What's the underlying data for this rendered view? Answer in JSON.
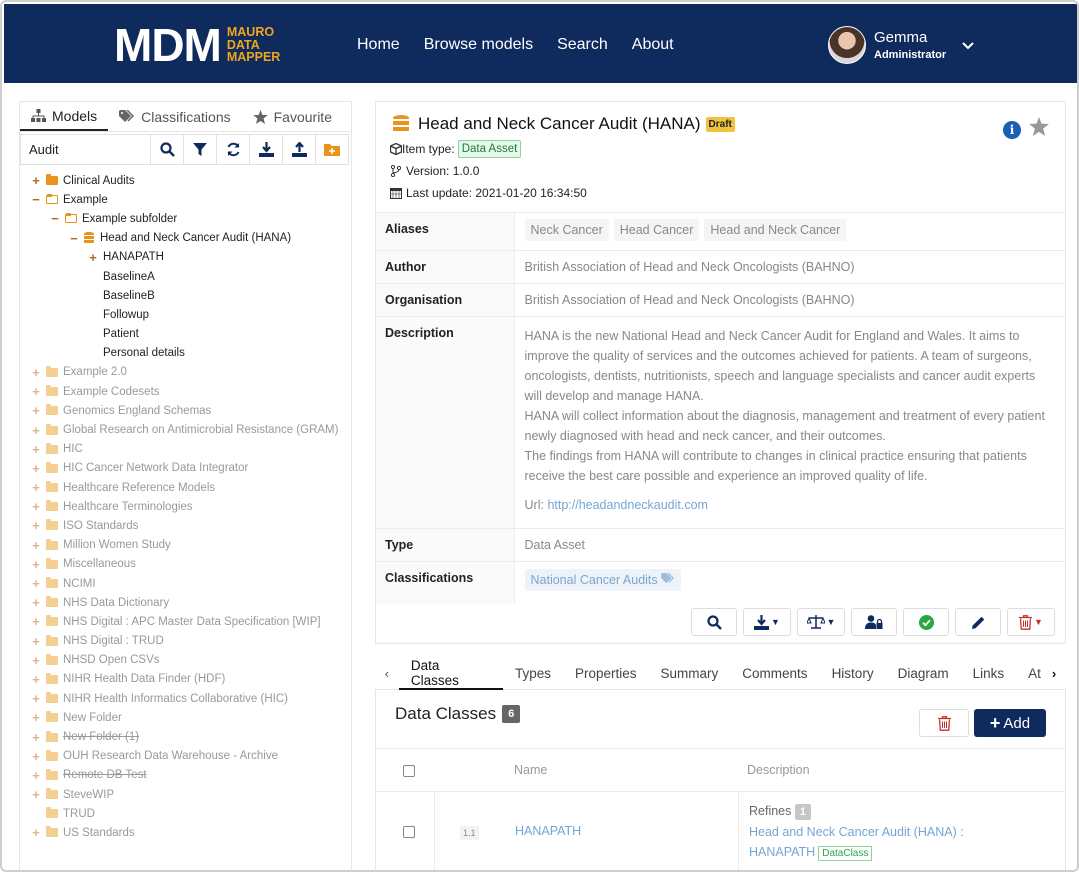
{
  "header": {
    "logo_main": "MDM",
    "logo_sub": [
      "MAURO",
      "DATA",
      "MAPPER"
    ],
    "nav": [
      "Home",
      "Browse models",
      "Search",
      "About"
    ],
    "user_name": "Gemma",
    "user_role": "Administrator"
  },
  "left": {
    "tabs": [
      "Models",
      "Classifications",
      "Favourite"
    ],
    "search_value": "Audit",
    "tree": [
      {
        "label": "Clinical Audits"
      },
      {
        "label": "Example"
      },
      {
        "label": "Example subfolder"
      },
      {
        "label": "Head and Neck Cancer Audit (HANA)"
      },
      {
        "label": "HANAPATH"
      },
      {
        "label": "BaselineA"
      },
      {
        "label": "BaselineB"
      },
      {
        "label": "Followup"
      },
      {
        "label": "Patient"
      },
      {
        "label": "Personal details"
      },
      {
        "label": "Example 2.0"
      },
      {
        "label": "Example Codesets"
      },
      {
        "label": "Genomics England Schemas"
      },
      {
        "label": "Global Research on Antimicrobial Resistance (GRAM)"
      },
      {
        "label": "HIC"
      },
      {
        "label": "HIC Cancer Network Data Integrator"
      },
      {
        "label": "Healthcare Reference Models"
      },
      {
        "label": "Healthcare Terminologies"
      },
      {
        "label": "ISO Standards"
      },
      {
        "label": "Million Women Study"
      },
      {
        "label": "Miscellaneous"
      },
      {
        "label": "NCIMI"
      },
      {
        "label": "NHS Data Dictionary"
      },
      {
        "label": "NHS Digital : APC Master Data Specification [WIP]"
      },
      {
        "label": "NHS Digital : TRUD"
      },
      {
        "label": "NHSD Open CSVs"
      },
      {
        "label": "NIHR Health Data Finder (HDF)"
      },
      {
        "label": "NIHR Health Informatics Collaborative (HIC)"
      },
      {
        "label": "New Folder"
      },
      {
        "label": "New Folder (1)"
      },
      {
        "label": "OUH Research Data Warehouse - Archive"
      },
      {
        "label": "Remote DB Test"
      },
      {
        "label": "SteveWIP"
      },
      {
        "label": "TRUD"
      },
      {
        "label": "US Standards"
      }
    ]
  },
  "detail": {
    "title": "Head and Neck Cancer Audit (HANA)",
    "status": "Draft",
    "item_type_label": "Item type:",
    "item_type": "Data Asset",
    "version": "Version: 1.0.0",
    "last_update": "Last update: 2021-01-20 16:34:50",
    "rows": {
      "aliases_label": "Aliases",
      "aliases": [
        "Neck Cancer",
        "Head Cancer",
        "Head and Neck Cancer"
      ],
      "author_label": "Author",
      "author": "British Association of Head and Neck Oncologists (BAHNO)",
      "organisation_label": "Organisation",
      "organisation": "British Association of Head and Neck Oncologists (BAHNO)",
      "description_label": "Description",
      "description_p1": "HANA is the new National Head and Neck Cancer Audit for England and Wales. It aims to improve the quality of services and the outcomes achieved for patients. A team of surgeons, oncologists, dentists, nutritionists, speech and language specialists and cancer audit experts will develop and manage HANA.",
      "description_p2": "HANA will collect information about the diagnosis, management and treatment of every patient newly diagnosed with head and neck cancer, and their outcomes.",
      "description_p3": "The findings from HANA will contribute to changes in clinical practice ensuring that patients receive the best care possible and experience an improved quality of life.",
      "url_label": "Url:",
      "url": "http://headandneckaudit.com",
      "type_label": "Type",
      "type": "Data Asset",
      "classifications_label": "Classifications",
      "classification": "National Cancer Audits"
    }
  },
  "tabs": [
    "Data Classes",
    "Types",
    "Properties",
    "Summary",
    "Comments",
    "History",
    "Diagram",
    "Links",
    "At"
  ],
  "data_classes": {
    "title": "Data Classes",
    "count": "6",
    "add_label": "Add",
    "col_name": "Name",
    "col_description": "Description",
    "row": {
      "index": "1.1",
      "name": "HANAPATH",
      "refines_label": "Refines",
      "refines_count": "1",
      "ref_line1": "Head and Neck Cancer Audit (HANA) :",
      "ref_line2": "HANAPATH",
      "ref_badge": "DataClass"
    }
  },
  "colors": {
    "navy": "#0f2a5c",
    "orange": "#e8941a",
    "draft": "#f0c33c"
  }
}
